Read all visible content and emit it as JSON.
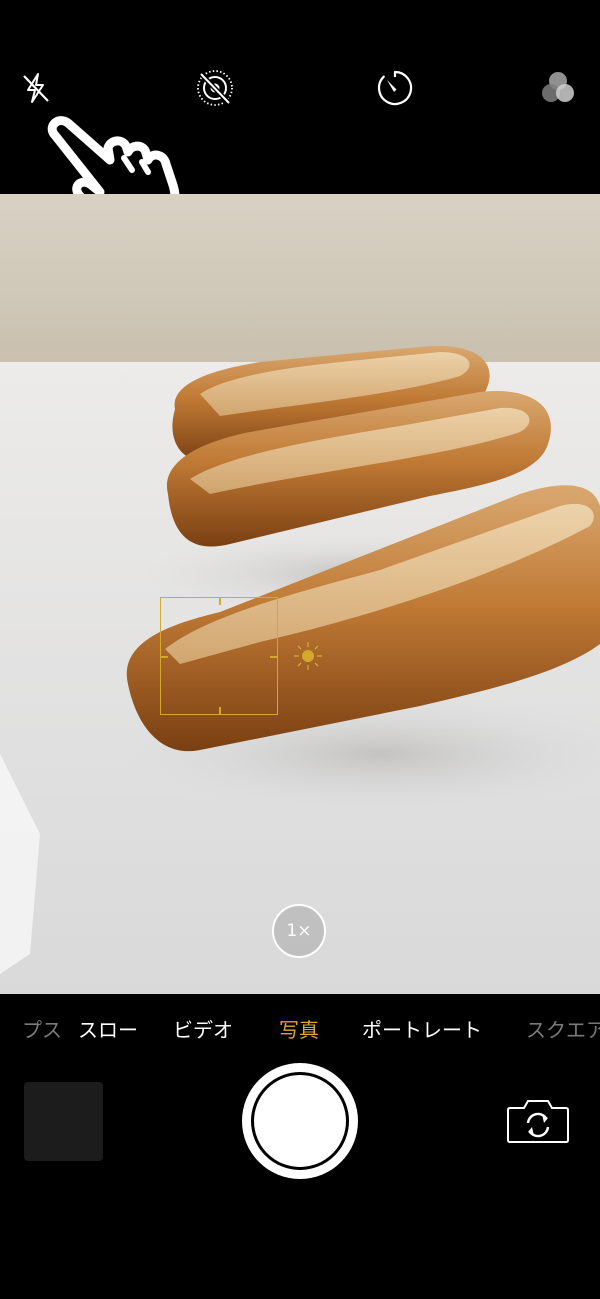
{
  "top_controls": {
    "flash_icon": "flash-off-icon",
    "live_photo_icon": "live-photo-off-icon",
    "timer_icon": "timer-icon",
    "filters_icon": "filters-icon"
  },
  "overlay": {
    "pointer_icon": "tap-hand-icon"
  },
  "viewfinder": {
    "subject": "three baguettes on white surface",
    "focus_color": "#d4a82a",
    "zoom_label": "1×"
  },
  "modes": {
    "items": [
      {
        "label": "プス",
        "state": "dim"
      },
      {
        "label": "スロー",
        "state": "normal"
      },
      {
        "label": "ビデオ",
        "state": "normal"
      },
      {
        "label": "写真",
        "state": "active"
      },
      {
        "label": "ポートレート",
        "state": "normal"
      },
      {
        "label": "スクエア",
        "state": "dim"
      }
    ],
    "active_color": "#e2a53a"
  },
  "bottom_controls": {
    "thumbnail_icon": "last-photo-thumbnail",
    "shutter_icon": "shutter-button",
    "switch_camera_icon": "switch-camera-icon"
  }
}
